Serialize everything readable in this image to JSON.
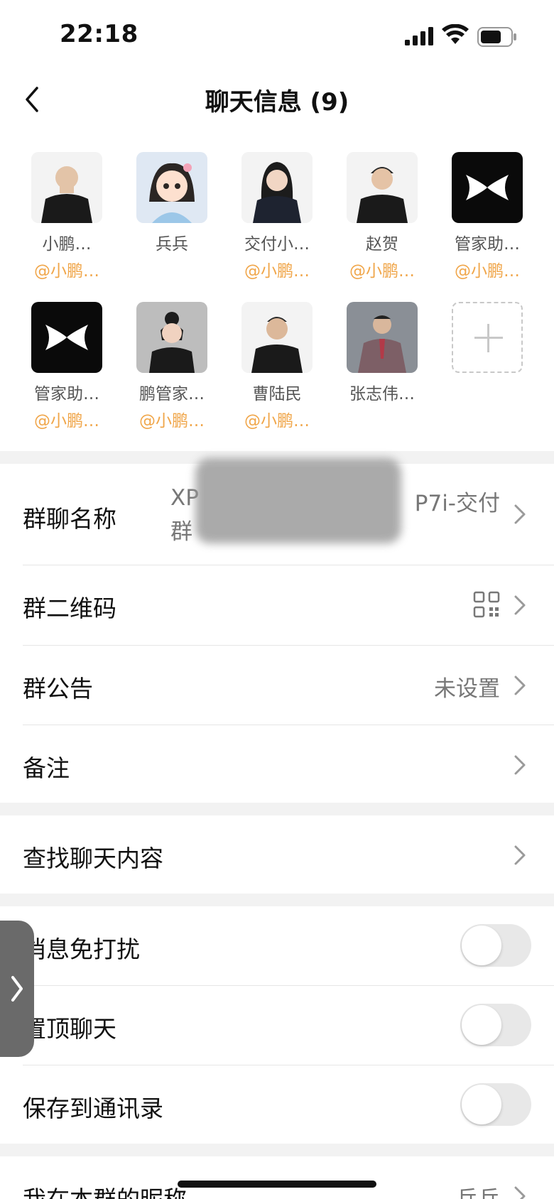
{
  "status_bar": {
    "time": "22:18"
  },
  "nav": {
    "title": "聊天信息 (9)"
  },
  "members": [
    {
      "name": "小鹏…",
      "sub": "@小鹏…",
      "avatar": "person-avatar"
    },
    {
      "name": "兵兵",
      "sub": "",
      "avatar": "cartoon-girl-avatar"
    },
    {
      "name": "交付小…",
      "sub": "@小鹏…",
      "avatar": "person-avatar"
    },
    {
      "name": "赵贺",
      "sub": "@小鹏…",
      "avatar": "person-avatar"
    },
    {
      "name": "管家助…",
      "sub": "@小鹏…",
      "avatar": "xpeng-logo-avatar"
    },
    {
      "name": "管家助…",
      "sub": "@小鹏…",
      "avatar": "xpeng-logo-avatar"
    },
    {
      "name": "鹏管家…",
      "sub": "@小鹏…",
      "avatar": "person-avatar"
    },
    {
      "name": "曹陆民",
      "sub": "@小鹏…",
      "avatar": "person-avatar"
    },
    {
      "name": "张志伟…",
      "sub": "",
      "avatar": "person-avatar"
    }
  ],
  "settings": {
    "group_name": {
      "label": "群聊名称",
      "value_line1": "XP",
      "value_end": "P7i-交付",
      "value_line2": "群"
    },
    "qr_code": {
      "label": "群二维码",
      "icon": "qr-code-icon"
    },
    "announcement": {
      "label": "群公告",
      "value": "未设置"
    },
    "remark": {
      "label": "备注"
    },
    "search": {
      "label": "查找聊天内容"
    },
    "mute": {
      "label": "消息免打扰",
      "on": false
    },
    "pin": {
      "label": "置顶聊天",
      "on": false
    },
    "save_contacts": {
      "label": "保存到通讯录",
      "on": false
    },
    "nickname": {
      "label": "我在本群的昵称",
      "value": "兵兵"
    }
  },
  "colors": {
    "accent_orange": "#f0a64a",
    "brand_black": "#0a0a0a",
    "background": "#f2f2f2"
  }
}
